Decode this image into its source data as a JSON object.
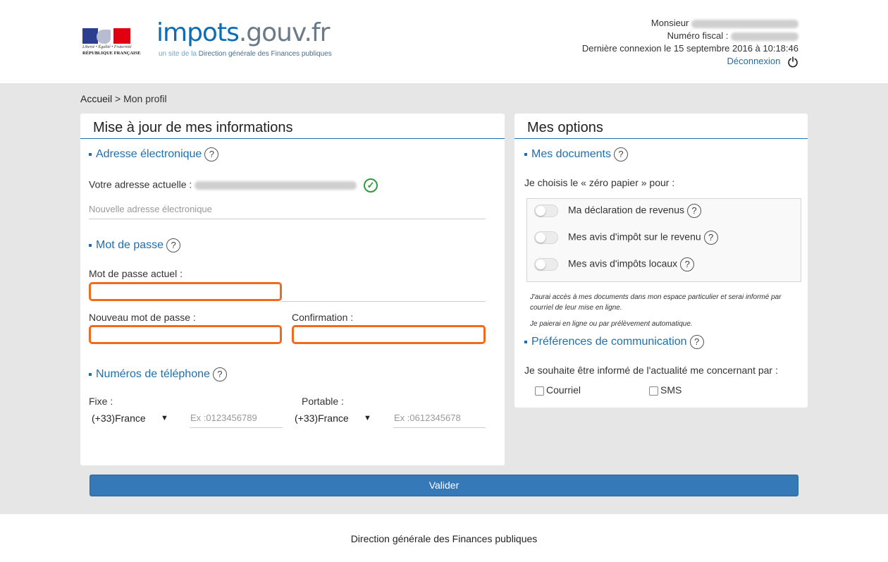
{
  "header": {
    "brand_main": "impots",
    "brand_domain": ".gouv.fr",
    "tagline_prefix": "un site de la",
    "tagline_main": " Direction générale des Finances publiques",
    "logo_motto": "Liberté • Égalité • Fraternité",
    "logo_republic": "RÉPUBLIQUE FRANÇAISE",
    "user_label": "Monsieur",
    "fiscal_label": "Numéro fiscal :",
    "last_login": "Dernière connexion le 15 septembre 2016 à 10:18:46",
    "logout": "Déconnexion"
  },
  "breadcrumb": {
    "home": "Accueil",
    "separator": " > ",
    "current": "Mon profil"
  },
  "left_panel": {
    "title": "Mise à jour de mes informations",
    "email_section": "Adresse électronique",
    "current_email_label": "Votre adresse actuelle :",
    "new_email_placeholder": "Nouvelle adresse électronique",
    "password_section": "Mot de passe",
    "current_password_label": "Mot de passe actuel :",
    "new_password_label": "Nouveau mot de passe :",
    "confirm_label": "Confirmation :",
    "phone_section": "Numéros de téléphone",
    "fixed_label": "Fixe :",
    "fixed_country": "(+33)France",
    "fixed_placeholder": "Ex :0123456789",
    "mobile_label": "Portable :",
    "mobile_country": "(+33)France",
    "mobile_placeholder": "Ex :0612345678"
  },
  "right_panel": {
    "title": "Mes options",
    "documents_section": "Mes documents",
    "zero_paper": "Je choisis le « zéro papier » pour :",
    "toggles": [
      {
        "label": "Ma déclaration de revenus",
        "on": false
      },
      {
        "label": "Mes avis d'impôt sur le revenu",
        "on": false
      },
      {
        "label": "Mes avis d'impôts locaux",
        "on": false
      }
    ],
    "note1": "J'aurai accès à mes documents dans mon espace particulier et serai informé par courriel de leur mise en ligne.",
    "note2": "Je paierai en ligne ou par prélèvement automatique.",
    "communication_section": "Préférences de communication",
    "communication_text": "Je souhaite être informé de l'actualité me concernant par :",
    "checkbox_email": "Courriel",
    "checkbox_sms": "SMS"
  },
  "actions": {
    "submit": "Valider"
  },
  "footer": {
    "text": "Direction générale des Finances publiques"
  },
  "colors": {
    "accent": "#1d6fb0",
    "error_border": "#f26b1d",
    "success": "#2e9b3e",
    "button": "#3579b9",
    "band": "#e6e6e6"
  },
  "icons": [
    "marianne-logo",
    "help-icon",
    "check-circle-icon",
    "power-icon",
    "chevron-down-icon"
  ]
}
